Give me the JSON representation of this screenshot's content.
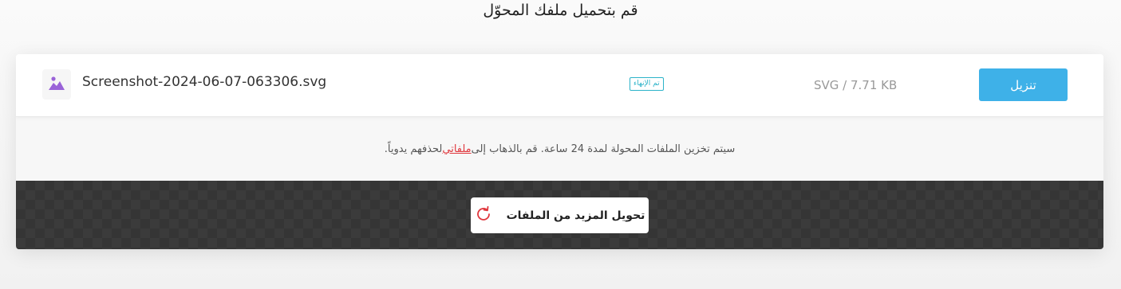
{
  "heading": "قم بتحميل ملفك المحوّل",
  "file": {
    "name": "Screenshot-2024-06-07-063306.svg",
    "status_badge": "تم الإنهاء",
    "size": "SVG / 7.71 KB",
    "download_label": "تنزيل",
    "thumb_icon": "image-icon"
  },
  "notice": {
    "text_before": "سيتم تخزين الملفات المحولة لمدة 24 ساعة. قم بالذهاب إلى ",
    "link": "ملفاتي",
    "text_after": " لحذفهم يدوياً."
  },
  "convert_more": {
    "label": "تحويل المزيد من الملفات",
    "icon": "refresh-icon"
  },
  "colors": {
    "accent": "#3eb1e8",
    "badge": "#2bb3c9",
    "link": "#e0383e",
    "thumb_icon": "#9a63d8"
  }
}
